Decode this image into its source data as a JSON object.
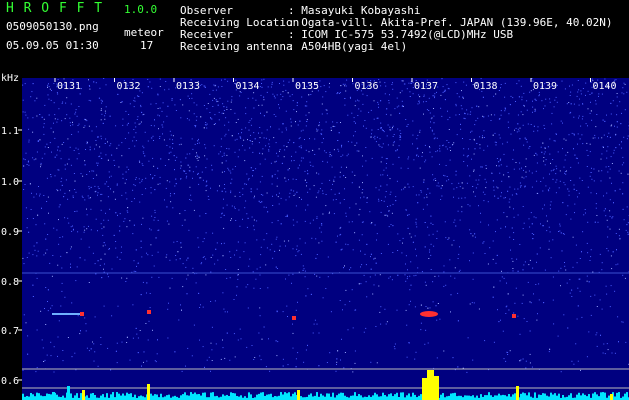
{
  "header": {
    "app_name": "H R O F F T",
    "app_version": "1.0.0",
    "filename": "0509050130.png",
    "datetime": "05.09.05 01:30",
    "meteor_label": "meteor",
    "meteor_count": "17",
    "info": [
      {
        "label": "Observer",
        "value": ": Masayuki Kobayashi"
      },
      {
        "label": "Receiving Location",
        "value": ": Ogata-vill. Akita-Pref. JAPAN (139.96E, 40.02N)"
      },
      {
        "label": "Receiver",
        "value": ": ICOM IC-575 53.7492(@LCD)MHz USB"
      },
      {
        "label": "Receiving antenna",
        "value": ": A504HB(yagi 4el)"
      }
    ]
  },
  "spectrogram": {
    "y_unit": "kHz",
    "y_ticks": [
      "1.1",
      "1.0",
      "0.9",
      "0.8",
      "0.7",
      "0.6"
    ],
    "time_labels": [
      "0131",
      "0132",
      "0133",
      "0134",
      "0135",
      "0136",
      "0137",
      "0138",
      "0139",
      "0140"
    ],
    "colors": {
      "background": "#000080",
      "noise": "#4a5cff",
      "label": "#ffffff",
      "tick": "#ffffff",
      "histogram": "#00e5ff",
      "meteor_peak": "#ffff00",
      "echo": "#ff3030"
    }
  }
}
